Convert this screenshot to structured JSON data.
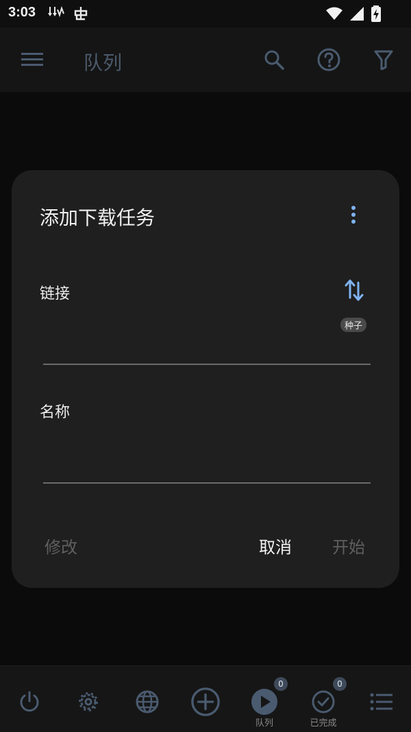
{
  "status_bar": {
    "time": "3:03"
  },
  "app_bar": {
    "title": "队列"
  },
  "dialog": {
    "title": "添加下载任务",
    "link_label": "链接",
    "link_value": "",
    "torrent_chip": "种子",
    "name_label": "名称",
    "name_value": "",
    "modify_label": "修改",
    "cancel_label": "取消",
    "start_label": "开始"
  },
  "bottom_nav": {
    "queue_label": "队列",
    "queue_badge": "0",
    "completed_label": "已完成",
    "completed_badge": "0"
  },
  "colors": {
    "accent_icon": "#4a5b70",
    "dialog_bg": "#1f1f1f",
    "accent_blue": "#7fb3f0"
  }
}
